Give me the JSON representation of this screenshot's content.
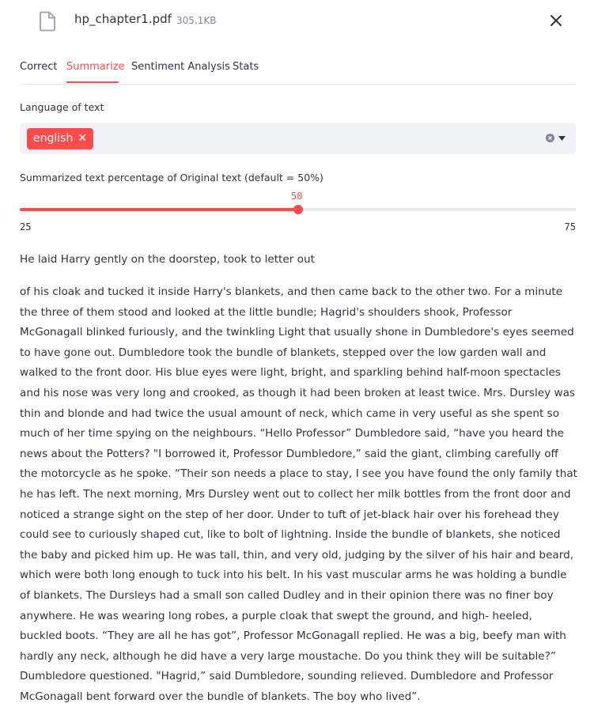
{
  "file": {
    "name": "hp_chapter1.pdf",
    "size": "305.1KB"
  },
  "tabs": [
    {
      "label": "Correct",
      "active": false
    },
    {
      "label": "Summarize",
      "active": true
    },
    {
      "label": "Sentiment Analysis",
      "active": false
    },
    {
      "label": "Stats",
      "active": false
    }
  ],
  "language": {
    "label": "Language of text",
    "selected": "english",
    "chip_remove": "✕"
  },
  "slider": {
    "label": "Summarized text percentage of Original text (default = 50%)",
    "value": "50",
    "min": "25",
    "max": "75",
    "fraction": 0.5
  },
  "summary": {
    "first_paragraph": "He laid Harry gently on the doorstep, took to letter out",
    "body": "of his cloak and tucked it inside Harry's blankets, and then came back to the other two. For a minute the three of them stood and looked at the little bundle; Hagrid's shoulders shook, Professor McGonagall blinked furiously, and the twinkling Light that usually shone in Dumbledore's eyes seemed to have gone out. Dumbledore took the bundle of blankets, stepped over the low garden wall and walked to the front door. His blue eyes were light, bright, and sparkling behind half-moon spectacles and his nose was very long and crooked, as though it had been broken at least twice. Mrs. Dursley was thin and blonde and had twice the usual amount of neck, which came in very useful as she spent so much of her time spying on the neighbours. “Hello Professor” Dumbledore said, “have you heard the news about the Potters? \"I borrowed it, Professor Dumbledore,” said the giant, climbing carefully off the motorcycle as he spoke. “Their son needs a place to stay, I see you have found the only family that he has left. The next morning, Mrs Dursley went out to collect her milk bottles from the front door and noticed a strange sight on the step of her door. Under to tuft of jet-black hair over his forehead they could see to curiously shaped cut, like to bolt of lightning. Inside the bundle of blankets, she noticed the baby and picked him up. He was tall, thin, and very old, judging by the silver of his hair and beard, which were both long enough to tuck into his belt. In his vast muscular arms he was holding a bundle of blankets. The Dursleys had a small son called Dudley and in their opinion there was no finer boy anywhere. He was wearing long robes, a purple cloak that swept the ground, and high- heeled, buckled boots. “They are all he has got”, Professor McGonagall replied. He was a big, beefy man with hardly any neck, although he did have a very large moustache. Do you think they will be suitable?” Dumbledore questioned. \"Hagrid,” said Dumbledore, sounding relieved. Dumbledore and Professor McGonagall bent forward over the bundle of blankets. The boy who lived”."
  },
  "icons": {
    "file": "file-icon",
    "close": "close-icon",
    "clear": "clear-circle-icon",
    "caret": "caret-down-icon"
  },
  "colors": {
    "accent": "#ff4b4b",
    "text": "#31333f",
    "muted": "#808495",
    "input_bg": "#f0f2f6",
    "track": "#e6e9ef"
  }
}
